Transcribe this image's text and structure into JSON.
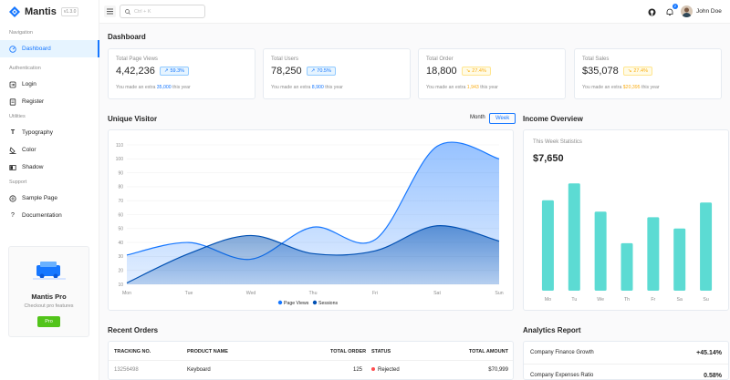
{
  "brand": {
    "name": "Mantis",
    "version": "v1.3.0"
  },
  "sidebar": {
    "groups": [
      {
        "label": "Navigation",
        "items": [
          {
            "label": "Dashboard",
            "icon": "dashboard-icon",
            "active": true
          }
        ]
      },
      {
        "label": "Authentication",
        "items": [
          {
            "label": "Login",
            "icon": "login-icon"
          },
          {
            "label": "Register",
            "icon": "register-icon"
          }
        ]
      },
      {
        "label": "Utilities",
        "items": [
          {
            "label": "Typography",
            "icon": "typography-icon"
          },
          {
            "label": "Color",
            "icon": "color-icon"
          },
          {
            "label": "Shadow",
            "icon": "shadow-icon"
          }
        ]
      },
      {
        "label": "Support",
        "items": [
          {
            "label": "Sample Page",
            "icon": "sample-page-icon"
          },
          {
            "label": "Documentation",
            "icon": "documentation-icon"
          }
        ]
      }
    ],
    "promo": {
      "title": "Mantis Pro",
      "subtitle": "Checkout pro features",
      "button": "Pro"
    }
  },
  "header": {
    "search_placeholder": "Ctrl + K",
    "notifications_count": "2",
    "user_name": "John Doe"
  },
  "main": {
    "title": "Dashboard",
    "stats": [
      {
        "label": "Total Page Views",
        "value": "4,42,236",
        "pct": "59.3%",
        "tone": "blue",
        "note_pre": "You made an extra ",
        "note_hl": "35,000",
        "note_post": " this year"
      },
      {
        "label": "Total Users",
        "value": "78,250",
        "pct": "70.5%",
        "tone": "blue",
        "note_pre": "You made an extra ",
        "note_hl": "8,900",
        "note_post": " this year"
      },
      {
        "label": "Total Order",
        "value": "18,800",
        "pct": "27.4%",
        "tone": "amber",
        "note_pre": "You made an extra ",
        "note_hl": "1,943",
        "note_post": " this year"
      },
      {
        "label": "Total Sales",
        "value": "$35,078",
        "pct": "27.4%",
        "tone": "amber",
        "note_pre": "You made an extra ",
        "note_hl": "$20,395",
        "note_post": " this year"
      }
    ],
    "unique_visitor": {
      "title": "Unique Visitor",
      "toggle_month": "Month",
      "toggle_week": "Week"
    },
    "income": {
      "title": "Income Overview",
      "subtitle": "This Week Statistics",
      "value": "$7,650"
    },
    "recent_orders": {
      "title": "Recent Orders",
      "headers": [
        "TRACKING NO.",
        "PRODUCT NAME",
        "TOTAL ORDER",
        "STATUS",
        "TOTAL AMOUNT"
      ],
      "rows": [
        {
          "tracking": "13256498",
          "product": "Keyboard",
          "total": "125",
          "status": "Rejected",
          "amount": "$70,999"
        }
      ]
    },
    "analytics": {
      "title": "Analytics Report",
      "rows": [
        {
          "label": "Company Finance Growth",
          "value": "+45.14%"
        },
        {
          "label": "Company Expenses Ratio",
          "value": "0.58%"
        }
      ]
    }
  },
  "chart_data": [
    {
      "type": "area",
      "categories": [
        "Mon",
        "Tue",
        "Wed",
        "Thu",
        "Fri",
        "Sat",
        "Sun"
      ],
      "ylim": [
        10,
        110
      ],
      "yticks": [
        10,
        20,
        30,
        40,
        50,
        60,
        70,
        80,
        90,
        100,
        110
      ],
      "series": [
        {
          "name": "Page Views",
          "values": [
            31,
            40,
            28,
            51,
            42,
            109,
            100
          ],
          "color": "#1677ff"
        },
        {
          "name": "Sessions",
          "values": [
            11,
            32,
            45,
            32,
            34,
            52,
            41
          ],
          "color": "#0050b3"
        }
      ],
      "legend": "bottom"
    },
    {
      "type": "bar",
      "categories": [
        "Mo",
        "Tu",
        "We",
        "Th",
        "Fr",
        "Sa",
        "Su"
      ],
      "values": [
        80,
        95,
        70,
        42,
        65,
        55,
        78
      ],
      "color": "#5cdbd3"
    }
  ]
}
